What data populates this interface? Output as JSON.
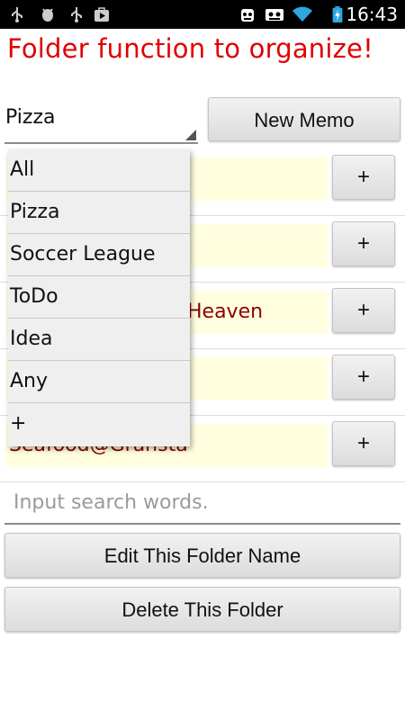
{
  "status_bar": {
    "time": "16:43",
    "left_icons": [
      "usb-icon",
      "android-debug-icon",
      "usb-icon",
      "play-store-icon"
    ],
    "right_icons": [
      "app-notification-icon",
      "tape-icon",
      "wifi-icon",
      "battery-charging-icon"
    ]
  },
  "title": "Folder function to organize!",
  "folder_select": {
    "value": "Pizza"
  },
  "new_memo_label": "New Memo",
  "memos": [
    {
      "text": ""
    },
    {
      "text": ""
    },
    {
      "text": "Heaven"
    },
    {
      "text": ""
    },
    {
      "text": "Seafood@Gransta"
    }
  ],
  "add_button_label": "+",
  "dropdown": {
    "items": [
      "All",
      "Pizza",
      "Soccer League",
      "ToDo",
      "Idea",
      "Any",
      "+"
    ]
  },
  "search": {
    "placeholder": "Input search words."
  },
  "edit_folder_label": "Edit This Folder Name",
  "delete_folder_label": "Delete This Folder",
  "colors": {
    "title": "#e00000",
    "memo_bg": "#ffffe0",
    "memo_text": "#8b0000"
  }
}
